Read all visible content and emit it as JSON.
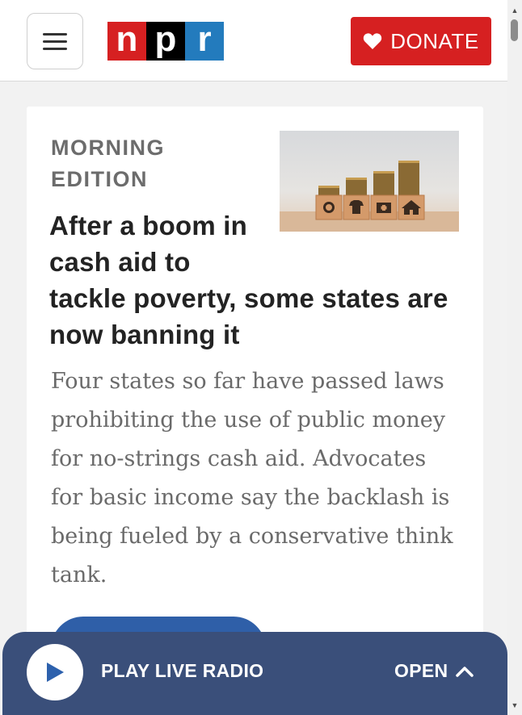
{
  "header": {
    "menu_icon": "hamburger-icon",
    "logo_letters": [
      "n",
      "p",
      "r"
    ],
    "donate_icon": "heart-icon",
    "donate_label": "DONATE"
  },
  "story": {
    "slug": "MORNING EDITION",
    "headline_short": "After a boom in cash aid to",
    "headline_rest": "tackle poverty, some states are now banning it",
    "teaser": "Four states so far have passed laws prohibiting the use of public money for no-strings cash aid. Advocates for basic income say the backlash is being fueled by a conservative think tank.",
    "image_icons": [
      "plate-icon",
      "shirt-icon",
      "medical-kit-icon",
      "house-icon"
    ]
  },
  "player": {
    "play_icon": "play-icon",
    "label": "PLAY LIVE RADIO",
    "open_label": "OPEN",
    "open_icon": "chevron-up-icon"
  },
  "colors": {
    "npr_red": "#d62021",
    "npr_black": "#000000",
    "npr_blue": "#237bbd",
    "player_bg": "#3a4f7a",
    "button_blue": "#2f5fa8"
  }
}
